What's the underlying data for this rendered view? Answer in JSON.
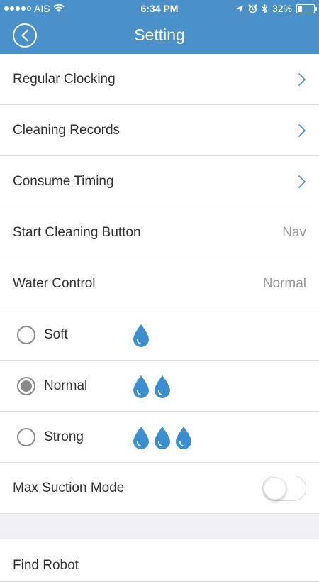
{
  "status_bar": {
    "carrier": "AIS",
    "time": "6:34 PM",
    "battery": "32%",
    "battery_level": 0.32
  },
  "nav": {
    "title": "Setting"
  },
  "menu": {
    "regular_clocking": "Regular Clocking",
    "cleaning_records": "Cleaning Records",
    "consume_timing": "Consume Timing",
    "start_cleaning_button": {
      "label": "Start Cleaning Button",
      "value": "Nav"
    },
    "water_control": {
      "label": "Water Control",
      "value": "Normal"
    }
  },
  "water_options": [
    {
      "label": "Soft",
      "drops": 1,
      "selected": false
    },
    {
      "label": "Normal",
      "drops": 2,
      "selected": true
    },
    {
      "label": "Strong",
      "drops": 3,
      "selected": false
    }
  ],
  "max_suction": {
    "label": "Max Suction Mode",
    "enabled": false
  },
  "find_robot": "Find Robot",
  "colors": {
    "accent": "#4a90c9",
    "drop": "#3a8fd0"
  }
}
